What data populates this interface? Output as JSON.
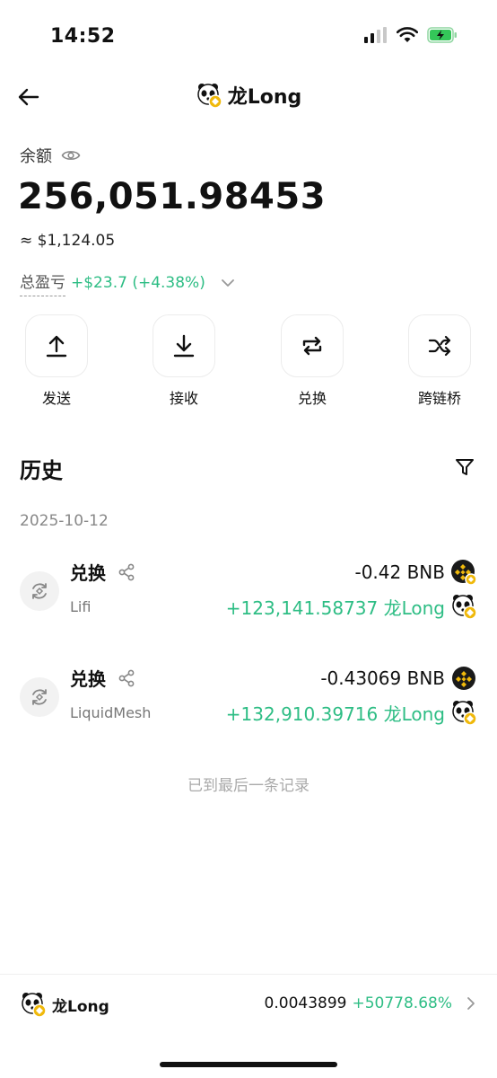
{
  "status": {
    "time": "14:52"
  },
  "nav": {
    "title": "龙Long"
  },
  "balance": {
    "label": "余额",
    "amount": "256,051.98453",
    "usd": "≈ $1,124.05",
    "pnl_label": "总盈亏",
    "pnl_value": "+$23.7 (+4.38%)"
  },
  "actions": [
    {
      "label": "发送",
      "icon": "upload-icon"
    },
    {
      "label": "接收",
      "icon": "download-icon"
    },
    {
      "label": "兑换",
      "icon": "swap-icon"
    },
    {
      "label": "跨链桥",
      "icon": "shuffle-icon"
    }
  ],
  "history": {
    "title": "历史",
    "date": "2025-10-12",
    "transactions": [
      {
        "type": "兑换",
        "source": "Lifi",
        "out": "-0.42 BNB",
        "in": "+123,141.58737 龙Long"
      },
      {
        "type": "兑换",
        "source": "LiquidMesh",
        "out": "-0.43069 BNB",
        "in": "+132,910.39716 龙Long"
      }
    ],
    "end_message": "已到最后一条记录"
  },
  "bottom": {
    "token": "龙Long",
    "price": "0.0043899",
    "change": "+50778.68%"
  },
  "colors": {
    "positive": "#2dbd84",
    "muted": "#888888",
    "bnb_gold": "#f0b90b"
  }
}
